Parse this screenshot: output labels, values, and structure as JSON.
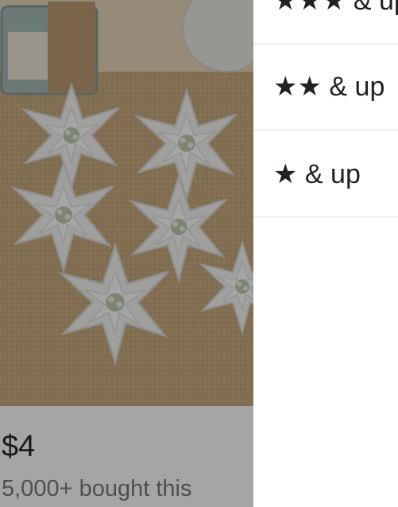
{
  "product": {
    "image_alt": "white-poinsettia-flowers",
    "price": "$4",
    "bought_text": "5,000+ bought this"
  },
  "rating_filter": {
    "options": [
      {
        "label": "★★★ & up"
      },
      {
        "label": "★★ & up"
      },
      {
        "label": "★ & up"
      }
    ]
  },
  "colors": {
    "overlay": "rgba(40,40,40,0.42)",
    "text": "#1f2328",
    "divider": "#efefef"
  }
}
